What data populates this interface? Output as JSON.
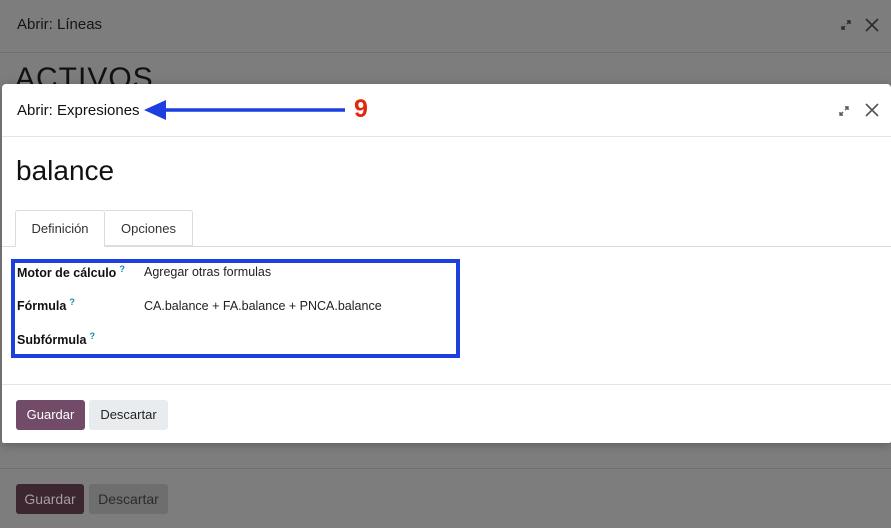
{
  "outer_dialog": {
    "title": "Abrir: Líneas",
    "record_heading": "ACTIVOS",
    "save_label": "Guardar",
    "discard_label": "Descartar"
  },
  "dialog": {
    "title": "Abrir: Expresiones",
    "record_title": "balance",
    "tabs": [
      {
        "label": "Definición",
        "active": true
      },
      {
        "label": "Opciones",
        "active": false
      }
    ],
    "fields": {
      "engine": {
        "label": "Motor de cálculo",
        "help": "?",
        "value": "Agregar otras formulas"
      },
      "formula": {
        "label": "Fórmula",
        "help": "?",
        "value": "CA.balance + FA.balance + PNCA.balance"
      },
      "subformula": {
        "label": "Subfórmula",
        "help": "?",
        "value": ""
      }
    },
    "save_label": "Guardar",
    "discard_label": "Descartar"
  },
  "annotation": {
    "number": "9",
    "color": "#e0290f",
    "arrow_color": "#1d3fe0"
  },
  "icons": {
    "expand": "expand-icon",
    "close": "close-icon"
  }
}
